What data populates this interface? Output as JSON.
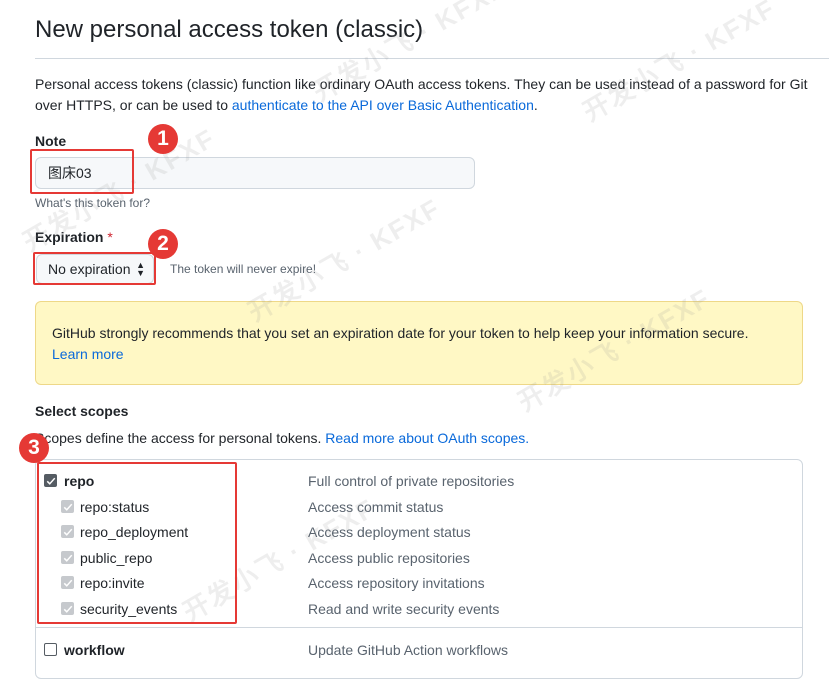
{
  "page": {
    "title": "New personal access token (classic)",
    "intro_text": "Personal access tokens (classic) function like ordinary OAuth access tokens. They can be used instead of a password for Git over HTTPS, or can be used to ",
    "intro_link": "authenticate to the API over Basic Authentication",
    "intro_end": "."
  },
  "note": {
    "label": "Note",
    "value": "图床03",
    "hint": "What's this token for?"
  },
  "expiration": {
    "label": "Expiration",
    "required_mark": "*",
    "selected": "No expiration",
    "hint": "The token will never expire!"
  },
  "warning": {
    "text": "GitHub strongly recommends that you set an expiration date for your token to help keep your information secure.",
    "link": "Learn more"
  },
  "scopes": {
    "heading": "Select scopes",
    "desc_text": "Scopes define the access for personal tokens. ",
    "desc_link": "Read more about OAuth scopes.",
    "items": [
      {
        "name": "repo",
        "description": "Full control of private repositories",
        "checked": true,
        "level": "parent"
      },
      {
        "name": "repo:status",
        "description": "Access commit status",
        "checked": true,
        "level": "child"
      },
      {
        "name": "repo_deployment",
        "description": "Access deployment status",
        "checked": true,
        "level": "child"
      },
      {
        "name": "public_repo",
        "description": "Access public repositories",
        "checked": true,
        "level": "child"
      },
      {
        "name": "repo:invite",
        "description": "Access repository invitations",
        "checked": true,
        "level": "child"
      },
      {
        "name": "security_events",
        "description": "Read and write security events",
        "checked": true,
        "level": "child"
      },
      {
        "name": "workflow",
        "description": "Update GitHub Action workflows",
        "checked": false,
        "level": "parent"
      }
    ]
  },
  "annotations": {
    "badges": [
      "1",
      "2",
      "3"
    ],
    "color": "#e53935"
  },
  "watermarks": [
    "开发小飞 · KFXF",
    "开发小飞 · KFXF",
    "开发小飞 · KFXF",
    "开发小飞 · KFXF",
    "开发小飞 · KFXF",
    "开发小飞 · KFXF"
  ],
  "colors": {
    "link": "#0969da",
    "required": "#cf222e",
    "warning_bg": "#fff8c5",
    "border": "#d0d7de",
    "muted": "#59636e"
  }
}
